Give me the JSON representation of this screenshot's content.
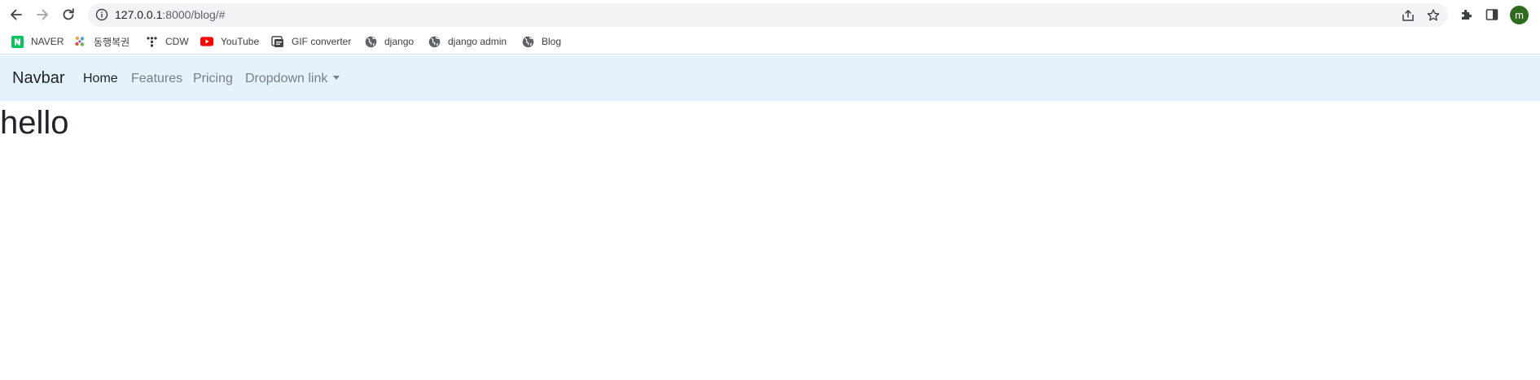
{
  "browser": {
    "url_host": "127.0.0.1",
    "url_path": ":8000/blog/#",
    "profile_initial": "m",
    "icons": {
      "back": "arrow-left-icon",
      "forward": "arrow-right-icon",
      "reload": "reload-icon",
      "site_info": "info-icon",
      "share": "share-icon",
      "bookmark_star": "star-icon",
      "extensions": "puzzle-icon",
      "side_panel": "side-panel-icon"
    },
    "colors": {
      "toolbar_bg": "#ffffff",
      "omnibox_bg": "#f1f3f4",
      "avatar_bg": "#2e6b1f"
    }
  },
  "bookmarks": [
    {
      "label": "NAVER",
      "icon": "naver-icon",
      "color": "#03c75a"
    },
    {
      "label": "동행복권",
      "icon": "lottery-icon",
      "color": "#e84a3c"
    },
    {
      "label": "CDW",
      "icon": "cdw-icon",
      "color": "#333333"
    },
    {
      "label": "YouTube",
      "icon": "youtube-icon",
      "color": "#ff0000"
    },
    {
      "label": "GIF converter",
      "icon": "gif-converter-icon",
      "color": "#444444"
    },
    {
      "label": "django",
      "icon": "globe-icon",
      "color": "#5f6368"
    },
    {
      "label": "django admin",
      "icon": "globe-icon",
      "color": "#5f6368"
    },
    {
      "label": "Blog",
      "icon": "globe-icon",
      "color": "#5f6368"
    }
  ],
  "page": {
    "navbar": {
      "brand": "Navbar",
      "background": "#e3f2fd",
      "links": [
        {
          "label": "Home",
          "active": true
        },
        {
          "label": "Features",
          "active": false
        },
        {
          "label": "Pricing",
          "active": false
        },
        {
          "label": "Dropdown link",
          "active": false,
          "dropdown": true
        }
      ]
    },
    "heading": "hello"
  }
}
